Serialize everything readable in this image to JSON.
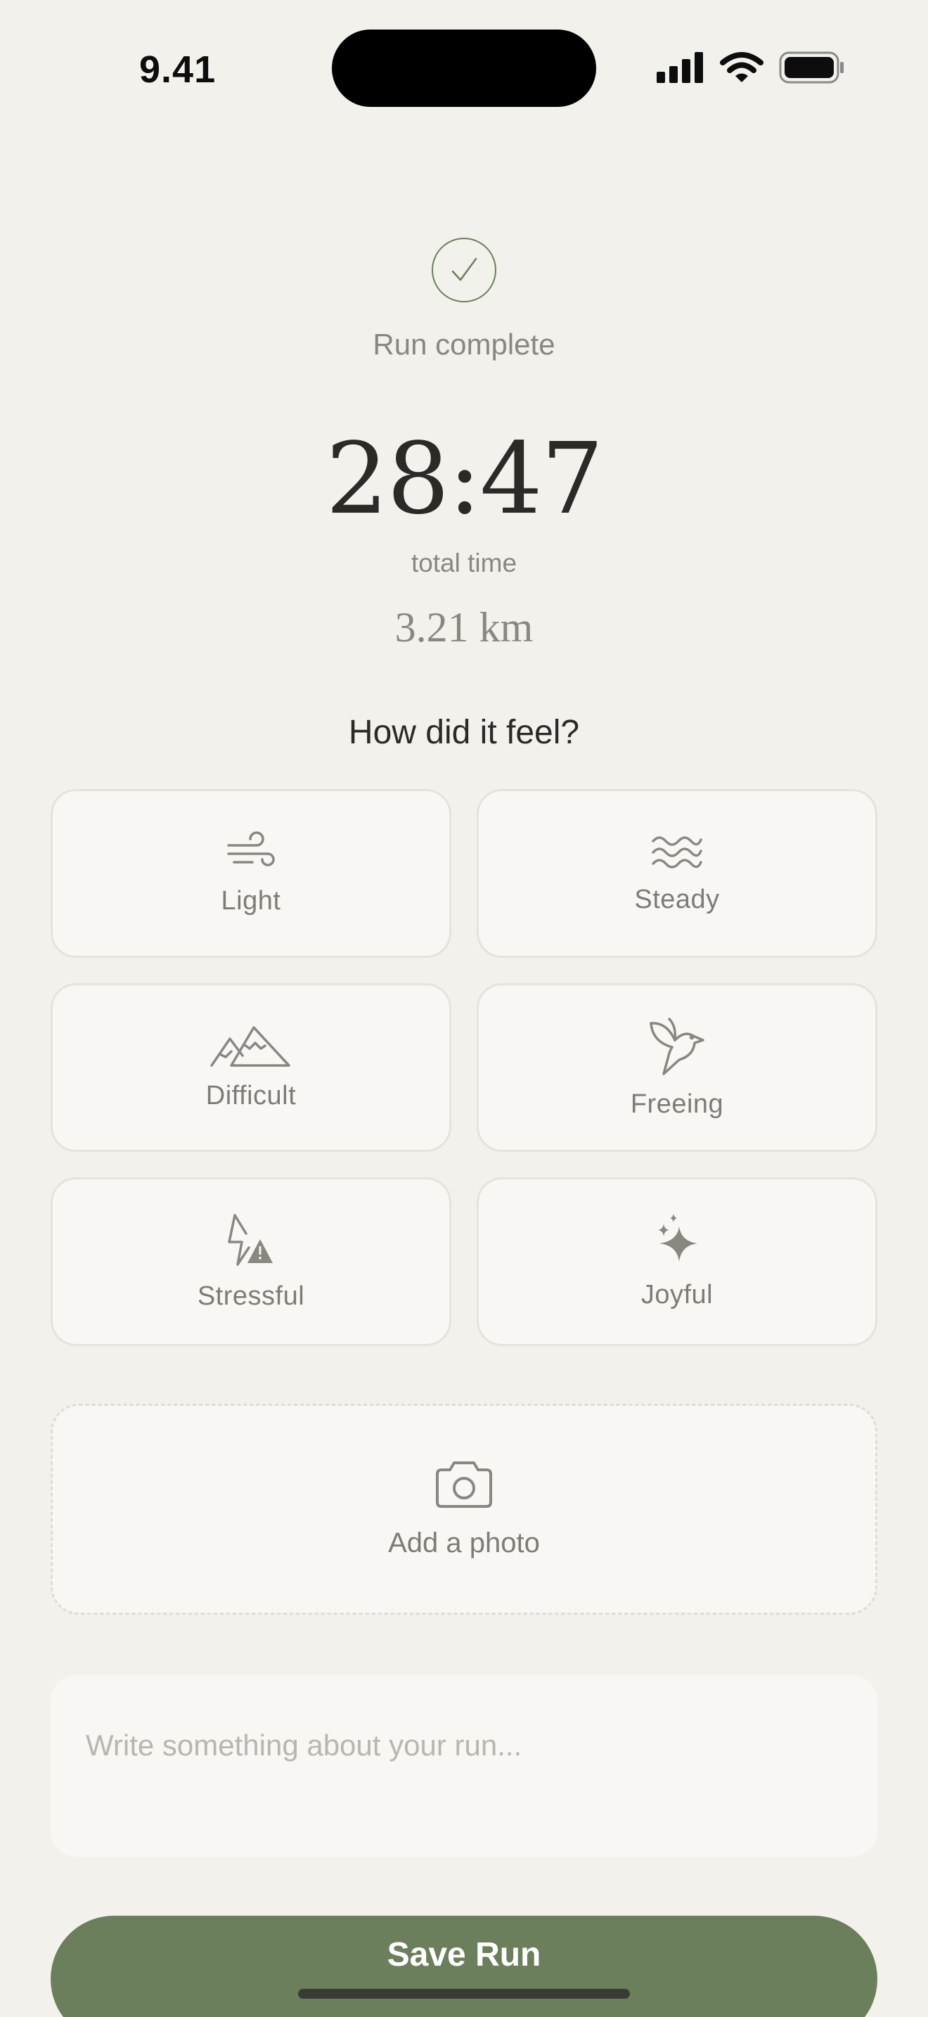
{
  "status_bar": {
    "time": "9.41",
    "icons": [
      "signal-bars-icon",
      "wifi-icon",
      "battery-icon"
    ]
  },
  "summary": {
    "check_icon": "checkmark-circle-icon",
    "status_text": "Run complete",
    "total_time": "28:47",
    "total_time_label": "total time",
    "distance": "3.21 km"
  },
  "mood": {
    "question": "How did it feel?",
    "options": [
      {
        "label": "Light",
        "icon": "wind-icon"
      },
      {
        "label": "Steady",
        "icon": "waves-icon"
      },
      {
        "label": "Difficult",
        "icon": "mountains-icon"
      },
      {
        "label": "Freeing",
        "icon": "bird-icon"
      },
      {
        "label": "Stressful",
        "icon": "bolt-warning-icon"
      },
      {
        "label": "Joyful",
        "icon": "sparkles-icon"
      }
    ]
  },
  "photo": {
    "label": "Add a photo",
    "icon": "camera-icon"
  },
  "notes": {
    "value": "",
    "placeholder": "Write something about your run..."
  },
  "actions": {
    "save_label": "Save Run"
  },
  "colors": {
    "background": "#f3f1eb",
    "card": "#f8f7f3",
    "accent": "#6b7f5c",
    "text_primary": "#2b2a26",
    "text_muted": "#8a8780"
  }
}
